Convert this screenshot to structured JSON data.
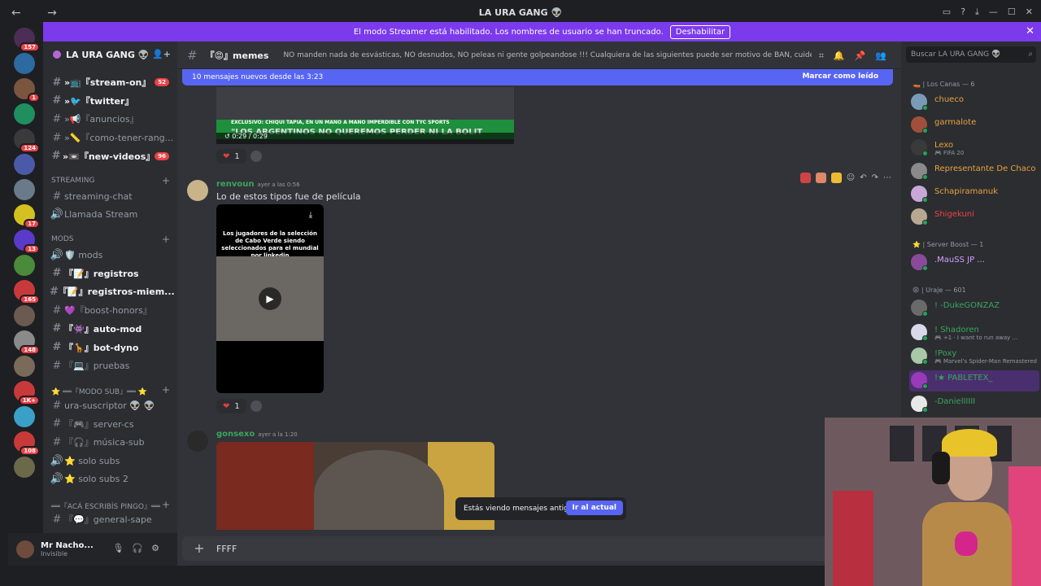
{
  "titlebar": {
    "title": "LA URA GANG 👽",
    "nav": "← →"
  },
  "banner": {
    "text": "El modo Streamer está habilitado. Los nombres de usuario se han truncado.",
    "button": "Deshabilitar"
  },
  "servers": [
    {
      "badge": "157"
    },
    {
      "badge": ""
    },
    {
      "badge": "1"
    },
    {
      "badge": ""
    },
    {
      "badge": "124"
    },
    {
      "badge": ""
    },
    {
      "badge": ""
    },
    {
      "badge": "17"
    },
    {
      "badge": "13"
    },
    {
      "badge": ""
    },
    {
      "badge": "165"
    },
    {
      "badge": ""
    },
    {
      "badge": "148"
    },
    {
      "badge": ""
    },
    {
      "badge": "1K+"
    },
    {
      "badge": ""
    },
    {
      "badge": "108"
    },
    {
      "badge": ""
    }
  ],
  "guild": {
    "name": "LA URA GANG 👽"
  },
  "channels": {
    "items": [
      {
        "name": "»📺『stream-on』",
        "badge": "52",
        "unread": true
      },
      {
        "name": "»🐦『twitter』",
        "badge": "",
        "unread": true
      },
      {
        "name": "»📢『anuncios』",
        "badge": "",
        "unread": false
      },
      {
        "name": "»📏『como-tener-rang...",
        "badge": "",
        "unread": false
      },
      {
        "name": "»📼『new-videos』",
        "badge": "96",
        "unread": true
      }
    ],
    "streaming_cat": "STREAMING",
    "streaming": [
      {
        "name": "streaming-chat",
        "icon": "#"
      },
      {
        "name": "Llamada Stream",
        "icon": "🔊"
      }
    ],
    "mods_cat": "mods",
    "mods": [
      {
        "name": "🛡️ mods",
        "icon": "🔊",
        "unread": false
      },
      {
        "name": "『📝』registros",
        "icon": "#",
        "unread": true
      },
      {
        "name": "『📝』registros-miem...",
        "icon": "#",
        "unread": true
      },
      {
        "name": "💜『boost-honors』",
        "icon": "#",
        "unread": false
      },
      {
        "name": "『👾』auto-mod",
        "icon": "#",
        "unread": true
      },
      {
        "name": "『🦒』bot-dyno",
        "icon": "#",
        "unread": true
      },
      {
        "name": "『💻』pruebas",
        "icon": "#",
        "unread": false
      }
    ],
    "sub_cat": "⭐ ══『MODO SUB』══ ⭐",
    "sub": [
      {
        "name": "ura-suscriptor 👽 👽",
        "icon": "#"
      },
      {
        "name": "『🎮』server-cs",
        "icon": "#"
      },
      {
        "name": "『🎧』música-sub",
        "icon": "#"
      },
      {
        "name": "⭐ solo subs",
        "icon": "🔊"
      },
      {
        "name": "⭐ solo subs 2",
        "icon": "🔊"
      }
    ],
    "pingo_cat": "══『acá escribís pingo』══",
    "pingo": [
      {
        "name": "『💬』general-sape",
        "icon": "#"
      }
    ]
  },
  "user": {
    "name": "Mr Nacho...",
    "status": "Invisible"
  },
  "channel_header": {
    "name": "『😡』memes",
    "topic": "NO manden nada de esvásticas, NO desnudos, NO peleas ni gente golpeandose !!! Cualquiera de las siguientes puede ser motivo de BAN, cuiden el stream!"
  },
  "new_messages": {
    "text": "10 mensajes nuevos desde las 3:23",
    "mark": "Marcar como leído"
  },
  "messages": [
    {
      "video_caption_1": "EXCLUSIVO: CHIQUI TAPIA, EN UN MANO A MANO IMPERDIBLE CON TYC SPORTS",
      "video_caption_2": "\"LOS ARGENTINOS NO QUEREMOS PERDER NI LA BOLIT",
      "time": "0:29 / 0:29",
      "reaction_count": "1"
    },
    {
      "author": "renvoun",
      "timestamp": "ayer a las 0:56",
      "text": "Lo de estos tipos fue de película",
      "video_caption": "Los jugadores de la selección de Cabo Verde siendo seleccionados para el mundial por linkedin",
      "reaction_count": "1"
    },
    {
      "author": "gonsexo",
      "timestamp": "ayer a la 1:20"
    }
  ],
  "toast": {
    "text": "Estás viendo mensajes antiguos",
    "button": "Ir al actual"
  },
  "composer": {
    "value": "FFFF"
  },
  "members": {
    "search_placeholder": "Buscar LA URA GANG 👽",
    "group1": "🚤 | Los Canas — 6",
    "group1_members": [
      {
        "name": "chueco",
        "sub": "",
        "color": "#e8a33a"
      },
      {
        "name": "garmalote",
        "sub": "",
        "color": "#e8a33a"
      },
      {
        "name": "Lexo",
        "sub": "🎮 FIFA 20",
        "color": "#e8a33a"
      },
      {
        "name": "Representante De Chaco",
        "sub": "",
        "color": "#e8a33a"
      },
      {
        "name": "Schapiramanuk",
        "sub": "",
        "color": "#e8a33a"
      },
      {
        "name": "Shigekuni",
        "sub": "",
        "color": "#ed4245"
      }
    ],
    "group2": "⭐ | Server Boost — 1",
    "group2_members": [
      {
        "name": ".MauSS JP ...",
        "sub": "",
        "color": "#d8a0ff"
      }
    ],
    "group3": "😩 | Uraje — 601",
    "group3_members": [
      {
        "name": "! -DukeGONZAZ",
        "sub": "",
        "color": "#3ba55d"
      },
      {
        "name": "! Shadoren",
        "sub": "🎮 +1 · I want to run away ...",
        "color": "#3ba55d"
      },
      {
        "name": "!Poxy",
        "sub": "🎮 Marvel's Spider-Man Remastered",
        "color": "#3ba55d"
      },
      {
        "name": "!★ PABLETEX_",
        "sub": "",
        "color": "#3ba55d"
      },
      {
        "name": "-DanielIIIII",
        "sub": "",
        "color": "#3ba55d"
      }
    ]
  }
}
